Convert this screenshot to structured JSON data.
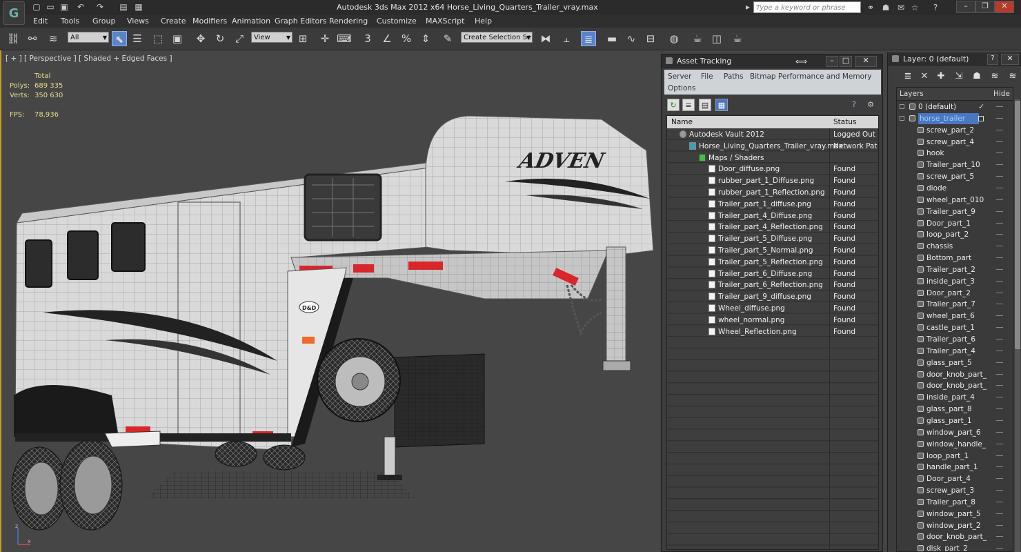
{
  "window": {
    "title": "Autodesk 3ds Max  2012 x64     Horse_Living_Quarters_Trailer_vray.max",
    "search_placeholder": "Type a keyword or phrase",
    "logo_glyph": "G"
  },
  "menu": [
    "Edit",
    "Tools",
    "Group",
    "Views",
    "Create",
    "Modifiers",
    "Animation",
    "Graph Editors",
    "Rendering",
    "Customize",
    "MAXScript",
    "Help"
  ],
  "toolbar": {
    "selection_filter": "All",
    "reference_coord": "View",
    "named_selection": "Create Selection Se",
    "snap_label": "3"
  },
  "viewport": {
    "label": "[ + ] [ Perspective ] [ Shaded + Edged Faces ]",
    "stats": {
      "total_label": "Total",
      "polys_label": "Polys:",
      "polys_value": "689 335",
      "verts_label": "Verts:",
      "verts_value": "350 630",
      "fps_label": "FPS:",
      "fps_value": "78,936"
    },
    "model_text": "ADVEN",
    "badge_text": "D&D",
    "axis_x": "x",
    "axis_z": "z"
  },
  "asset_tracking": {
    "title": "Asset Tracking",
    "menu": [
      "Server",
      "File",
      "Paths",
      "Bitmap Performance and Memory",
      "Options"
    ],
    "columns": {
      "name": "Name",
      "status": "Status"
    },
    "rows": [
      {
        "name": "Autodesk Vault 2012",
        "status": "Logged Out ...",
        "indent": 0,
        "kind": "vault"
      },
      {
        "name": "Horse_Living_Quarters_Trailer_vray.max",
        "status": "Network Path",
        "indent": 1,
        "kind": "max"
      },
      {
        "name": "Maps / Shaders",
        "status": "",
        "indent": 2,
        "kind": "folder"
      },
      {
        "name": "Door_diffuse.png",
        "status": "Found",
        "indent": 3,
        "kind": "file"
      },
      {
        "name": "rubber_part_1_Diffuse.png",
        "status": "Found",
        "indent": 3,
        "kind": "file"
      },
      {
        "name": "rubber_part_1_Reflection.png",
        "status": "Found",
        "indent": 3,
        "kind": "file"
      },
      {
        "name": "Trailer_part_1_diffuse.png",
        "status": "Found",
        "indent": 3,
        "kind": "file"
      },
      {
        "name": "Trailer_part_4_Diffuse.png",
        "status": "Found",
        "indent": 3,
        "kind": "file"
      },
      {
        "name": "Trailer_part_4_Reflection.png",
        "status": "Found",
        "indent": 3,
        "kind": "file"
      },
      {
        "name": "Trailer_part_5_Diffuse.png",
        "status": "Found",
        "indent": 3,
        "kind": "file"
      },
      {
        "name": "Trailer_part_5_Normal.png",
        "status": "Found",
        "indent": 3,
        "kind": "file"
      },
      {
        "name": "Trailer_part_5_Reflection.png",
        "status": "Found",
        "indent": 3,
        "kind": "file"
      },
      {
        "name": "Trailer_part_6_Diffuse.png",
        "status": "Found",
        "indent": 3,
        "kind": "file"
      },
      {
        "name": "Trailer_part_6_Reflection.png",
        "status": "Found",
        "indent": 3,
        "kind": "file"
      },
      {
        "name": "Trailer_part_9_diffuse.png",
        "status": "Found",
        "indent": 3,
        "kind": "file"
      },
      {
        "name": "Wheel_diffuse.png",
        "status": "Found",
        "indent": 3,
        "kind": "file"
      },
      {
        "name": "wheel_normal.png",
        "status": "Found",
        "indent": 3,
        "kind": "file"
      },
      {
        "name": "Wheel_Reflection.png",
        "status": "Found",
        "indent": 3,
        "kind": "file"
      }
    ]
  },
  "layer_panel": {
    "title": "Layer: 0 (default)",
    "columns": {
      "layers": "Layers",
      "hide": "Hide"
    },
    "layers": [
      {
        "name": "0 (default)",
        "level": 0,
        "current": true
      },
      {
        "name": "horse_trailer",
        "level": 0,
        "selected": true
      },
      {
        "name": "screw_part_2",
        "level": 1
      },
      {
        "name": "screw_part_4",
        "level": 1
      },
      {
        "name": "hook",
        "level": 1
      },
      {
        "name": "Trailer_part_10",
        "level": 1
      },
      {
        "name": "screw_part_5",
        "level": 1
      },
      {
        "name": "diode",
        "level": 1
      },
      {
        "name": "wheel_part_010",
        "level": 1
      },
      {
        "name": "Trailer_part_9",
        "level": 1
      },
      {
        "name": "Door_part_1",
        "level": 1
      },
      {
        "name": "loop_part_2",
        "level": 1
      },
      {
        "name": "chassis",
        "level": 1
      },
      {
        "name": "Bottom_part",
        "level": 1
      },
      {
        "name": "Trailer_part_2",
        "level": 1
      },
      {
        "name": "inside_part_3",
        "level": 1
      },
      {
        "name": "Door_part_2",
        "level": 1
      },
      {
        "name": "Trailer_part_7",
        "level": 1
      },
      {
        "name": "wheel_part_6",
        "level": 1
      },
      {
        "name": "castle_part_1",
        "level": 1
      },
      {
        "name": "Trailer_part_6",
        "level": 1
      },
      {
        "name": "Trailer_part_4",
        "level": 1
      },
      {
        "name": "glass_part_5",
        "level": 1
      },
      {
        "name": "door_knob_part_",
        "level": 1
      },
      {
        "name": "door_knob_part_",
        "level": 1
      },
      {
        "name": "inside_part_4",
        "level": 1
      },
      {
        "name": "glass_part_8",
        "level": 1
      },
      {
        "name": "glass_part_1",
        "level": 1
      },
      {
        "name": "window_part_6",
        "level": 1
      },
      {
        "name": "window_handle_",
        "level": 1
      },
      {
        "name": "loop_part_1",
        "level": 1
      },
      {
        "name": "handle_part_1",
        "level": 1
      },
      {
        "name": "Door_part_4",
        "level": 1
      },
      {
        "name": "screw_part_3",
        "level": 1
      },
      {
        "name": "Trailer_part_8",
        "level": 1
      },
      {
        "name": "window_part_5",
        "level": 1
      },
      {
        "name": "window_part_2",
        "level": 1
      },
      {
        "name": "door_knob_part_",
        "level": 1
      },
      {
        "name": "disk_part_2",
        "level": 1
      }
    ]
  },
  "colors": {
    "accent": "#c89b1e",
    "selection": "#4b77c2",
    "stats": "#e8dc8c",
    "marker": "#d8262a"
  }
}
